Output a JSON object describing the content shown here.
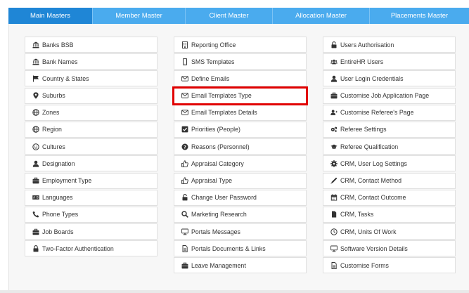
{
  "tabs": [
    {
      "label": "Main Masters",
      "active": true
    },
    {
      "label": "Member Master",
      "active": false
    },
    {
      "label": "Client Master",
      "active": false
    },
    {
      "label": "Allocation Master",
      "active": false
    },
    {
      "label": "Placements Master",
      "active": false
    }
  ],
  "columns": [
    [
      {
        "label": "Banks BSB",
        "icon": "bank-icon"
      },
      {
        "label": "Bank Names",
        "icon": "bank-icon"
      },
      {
        "label": "Country & States",
        "icon": "flag-icon"
      },
      {
        "label": "Suburbs",
        "icon": "map-marker-icon"
      },
      {
        "label": "Zones",
        "icon": "globe-icon"
      },
      {
        "label": "Region",
        "icon": "globe-icon"
      },
      {
        "label": "Cultures",
        "icon": "smile-icon"
      },
      {
        "label": "Designation",
        "icon": "user-icon"
      },
      {
        "label": "Employment Type",
        "icon": "briefcase-icon"
      },
      {
        "label": "Languages",
        "icon": "language-icon"
      },
      {
        "label": "Phone Types",
        "icon": "phone-icon"
      },
      {
        "label": "Job Boards",
        "icon": "briefcase-icon"
      },
      {
        "label": "Two-Factor Authentication",
        "icon": "lock-icon"
      }
    ],
    [
      {
        "label": "Reporting Office",
        "icon": "building-icon"
      },
      {
        "label": "SMS Templates",
        "icon": "mobile-icon"
      },
      {
        "label": "Define Emails",
        "icon": "envelope-icon"
      },
      {
        "label": "Email Templates Type",
        "icon": "envelope-icon",
        "highlighted": true
      },
      {
        "label": "Email Templates Details",
        "icon": "envelope-icon"
      },
      {
        "label": "Priorities (People)",
        "icon": "check-square-icon"
      },
      {
        "label": "Reasons (Personnel)",
        "icon": "question-circle-icon"
      },
      {
        "label": "Appraisal Category",
        "icon": "thumbs-up-icon"
      },
      {
        "label": "Appraisal Type",
        "icon": "thumbs-up-icon"
      },
      {
        "label": "Change User Password",
        "icon": "unlock-icon"
      },
      {
        "label": "Marketing Research",
        "icon": "search-icon"
      },
      {
        "label": "Portals Messages",
        "icon": "desktop-icon"
      },
      {
        "label": "Portals Documents & Links",
        "icon": "file-icon"
      },
      {
        "label": "Leave Management",
        "icon": "briefcase-icon"
      }
    ],
    [
      {
        "label": "Users Authorisation",
        "icon": "unlock-icon"
      },
      {
        "label": "EntireHR Users",
        "icon": "users-icon"
      },
      {
        "label": "User Login Credentials",
        "icon": "user-icon"
      },
      {
        "label": "Customise Job Application Page",
        "icon": "briefcase-icon"
      },
      {
        "label": "Customise Referee's Page",
        "icon": "user-plus-icon"
      },
      {
        "label": "Referee Settings",
        "icon": "cogs-icon"
      },
      {
        "label": "Referee Qualification",
        "icon": "graduation-cap-icon"
      },
      {
        "label": "CRM, User Log Settings",
        "icon": "gear-icon"
      },
      {
        "label": "CRM, Contact Method",
        "icon": "pen-icon"
      },
      {
        "label": "CRM, Contact Outcome",
        "icon": "calendar-icon"
      },
      {
        "label": "CRM, Tasks",
        "icon": "file-solid-icon"
      },
      {
        "label": "CRM, Units Of Work",
        "icon": "clock-icon"
      },
      {
        "label": "Software Version Details",
        "icon": "desktop-icon"
      },
      {
        "label": "Customise Forms",
        "icon": "file-icon"
      }
    ]
  ]
}
